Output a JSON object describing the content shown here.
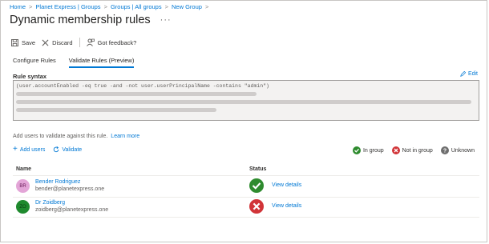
{
  "breadcrumb": [
    "Home",
    "Planet Express | Groups",
    "Groups | All groups",
    "New Group"
  ],
  "page_title": "Dynamic membership rules",
  "more_label": "···",
  "toolbar": {
    "save": "Save",
    "discard": "Discard",
    "feedback": "Got feedback?"
  },
  "tabs": [
    {
      "label": "Configure Rules",
      "active": false
    },
    {
      "label": "Validate Rules (Preview)",
      "active": true
    }
  ],
  "rule": {
    "label": "Rule syntax",
    "edit": "Edit",
    "text": "(user.accountEnabled -eq true -and -not user.userPrincipalName -contains \"admin\")"
  },
  "hint": {
    "text": "Add users to validate against this rule.",
    "link": "Learn more"
  },
  "actions": {
    "add": "Add users",
    "validate": "Validate"
  },
  "legend": {
    "in_group": "In group",
    "not_in_group": "Not in group",
    "unknown": "Unknown"
  },
  "table": {
    "col_name": "Name",
    "col_status": "Status",
    "rows": [
      {
        "initials": "BR",
        "name": "Bender Rodriguez",
        "email": "bender@planetexpress.one",
        "status": "in-group",
        "link": "View details",
        "avatar_bg": "#e3a5d7",
        "avatar_fg": "#6b1b59"
      },
      {
        "initials": "ZO",
        "name": "Dr Zoidberg",
        "email": "zoidberg@planetexpress.one",
        "status": "not-in-group",
        "link": "View details",
        "avatar_bg": "#1f8a2e",
        "avatar_fg": "#0b3b12"
      }
    ]
  },
  "colors": {
    "accent": "#0078d4",
    "success": "#2e8b2e",
    "error": "#d13438",
    "unknown": "#6e6e6e"
  }
}
